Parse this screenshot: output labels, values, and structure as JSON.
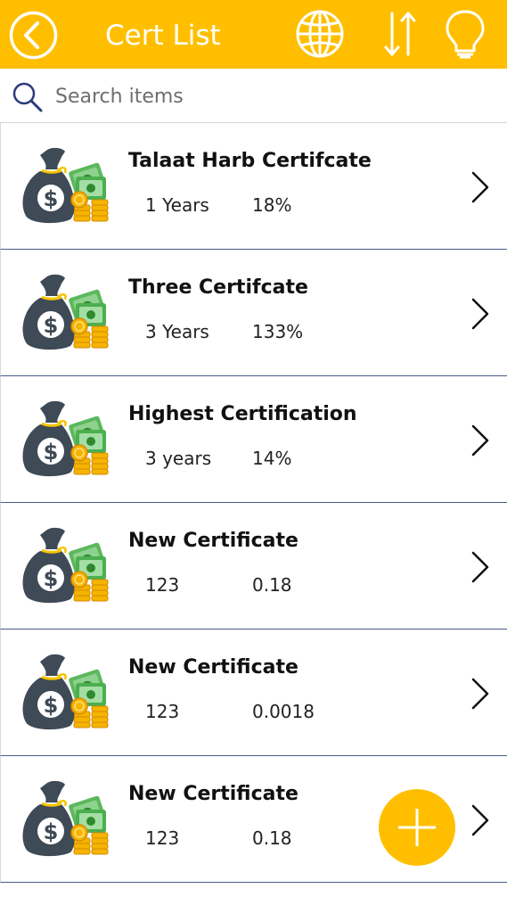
{
  "header": {
    "title": "Cert List",
    "background": "#FFBF00",
    "icons": [
      "back-circle-icon",
      "globe-icon",
      "sort-icon",
      "lightbulb-icon"
    ]
  },
  "search": {
    "placeholder": "Search items",
    "value": "",
    "icon": "search-icon"
  },
  "items": [
    {
      "title": "Talaat Harb Certifcate",
      "duration": "1 Years",
      "rate": "18%"
    },
    {
      "title": "Three Certifcate",
      "duration": "3 Years",
      "rate": "133%"
    },
    {
      "title": "Highest Certification",
      "duration": "3 years",
      "rate": "14%"
    },
    {
      "title": "New Certificate",
      "duration": "123",
      "rate": "0.18"
    },
    {
      "title": "New Certificate",
      "duration": "123",
      "rate": "0.0018"
    },
    {
      "title": "New Certificate",
      "duration": "123",
      "rate": "0.18"
    }
  ],
  "fab": {
    "icon": "plus-icon",
    "color": "#FFBF00"
  }
}
